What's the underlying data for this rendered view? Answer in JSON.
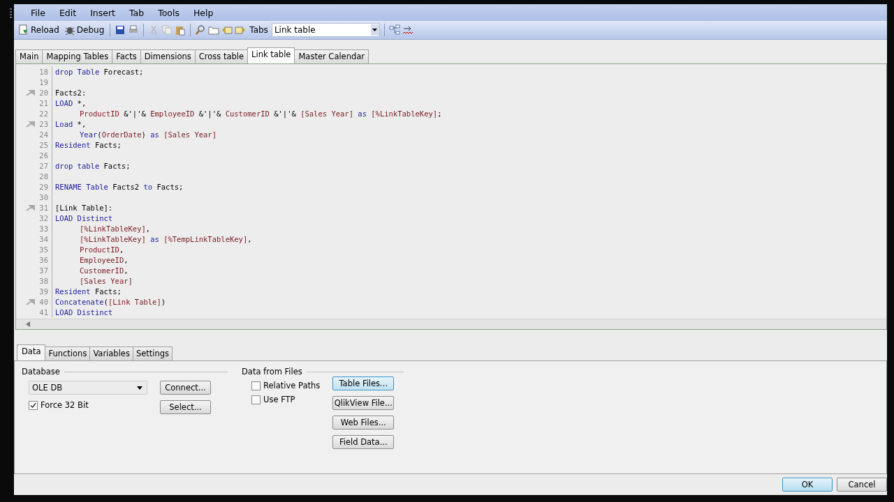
{
  "menu": [
    "File",
    "Edit",
    "Insert",
    "Tab",
    "Tools",
    "Help"
  ],
  "toolbar": {
    "reload": "Reload",
    "debug": "Debug",
    "tabs_label": "Tabs",
    "tabs_value": "Link table"
  },
  "script_tabs": [
    {
      "label": "Main",
      "selected": false
    },
    {
      "label": "Mapping Tables",
      "selected": false
    },
    {
      "label": "Facts",
      "selected": false
    },
    {
      "label": "Dimensions",
      "selected": false
    },
    {
      "label": "Cross table",
      "selected": false
    },
    {
      "label": "Link table",
      "selected": true
    },
    {
      "label": "Master Calendar",
      "selected": false
    }
  ],
  "editor": {
    "lines": [
      {
        "number": "18",
        "bookmark": false,
        "indent": false,
        "tokens": [
          {
            "kind": "keyword",
            "text": "drop Table"
          },
          {
            "kind": "plain",
            "text": " Forecast;"
          }
        ]
      },
      {
        "number": "19",
        "bookmark": false
      },
      {
        "number": "20",
        "bookmark": true,
        "indent": false,
        "tokens": [
          {
            "kind": "plain",
            "text": "Facts2:"
          }
        ]
      },
      {
        "number": "21",
        "bookmark": false,
        "indent": false,
        "tokens": [
          {
            "kind": "keyword",
            "text": "LOAD"
          },
          {
            "kind": "plain",
            "text": " *,"
          }
        ]
      },
      {
        "number": "22",
        "bookmark": false,
        "indent": true,
        "tokens": [
          {
            "kind": "field",
            "text": "ProductID"
          },
          {
            "kind": "plain",
            "text": " &'|'& "
          },
          {
            "kind": "field",
            "text": "EmployeeID"
          },
          {
            "kind": "plain",
            "text": " &'|'& "
          },
          {
            "kind": "field",
            "text": "CustomerID"
          },
          {
            "kind": "plain",
            "text": " &'|'& "
          },
          {
            "kind": "field",
            "text": "[Sales Year] "
          },
          {
            "kind": "keyword",
            "text": "as "
          },
          {
            "kind": "field",
            "text": "[%LinkTableKey]"
          },
          {
            "kind": "plain",
            "text": ";"
          }
        ]
      },
      {
        "number": "23",
        "bookmark": true,
        "indent": false,
        "tokens": [
          {
            "kind": "keyword",
            "text": "Load"
          },
          {
            "kind": "plain",
            "text": " *,"
          }
        ]
      },
      {
        "number": "24",
        "bookmark": false,
        "indent": true,
        "tokens": [
          {
            "kind": "keyword",
            "text": "Year"
          },
          {
            "kind": "plain",
            "text": "("
          },
          {
            "kind": "field",
            "text": "OrderDate"
          },
          {
            "kind": "plain",
            "text": ") "
          },
          {
            "kind": "keyword",
            "text": "as "
          },
          {
            "kind": "field",
            "text": "[Sales Year]"
          }
        ]
      },
      {
        "number": "25",
        "bookmark": false,
        "indent": false,
        "tokens": [
          {
            "kind": "keyword",
            "text": "Resident"
          },
          {
            "kind": "plain",
            "text": " Facts;"
          }
        ]
      },
      {
        "number": "26",
        "bookmark": false
      },
      {
        "number": "27",
        "bookmark": false,
        "indent": false,
        "tokens": [
          {
            "kind": "keyword",
            "text": "drop table"
          },
          {
            "kind": "plain",
            "text": " Facts;"
          }
        ]
      },
      {
        "number": "28",
        "bookmark": false
      },
      {
        "number": "29",
        "bookmark": false,
        "indent": false,
        "tokens": [
          {
            "kind": "keyword",
            "text": "RENAME Table"
          },
          {
            "kind": "plain",
            "text": " Facts2 "
          },
          {
            "kind": "keyword",
            "text": "to"
          },
          {
            "kind": "plain",
            "text": " Facts;"
          }
        ]
      },
      {
        "number": "30",
        "bookmark": false
      },
      {
        "number": "31",
        "bookmark": true,
        "indent": false,
        "tokens": [
          {
            "kind": "plain",
            "text": "[Link Table]:"
          }
        ]
      },
      {
        "number": "32",
        "bookmark": false,
        "indent": false,
        "tokens": [
          {
            "kind": "keyword",
            "text": "LOAD Distinct"
          }
        ]
      },
      {
        "number": "33",
        "bookmark": false,
        "indent": true,
        "tokens": [
          {
            "kind": "field",
            "text": "[%LinkTableKey]"
          },
          {
            "kind": "plain",
            "text": ","
          }
        ]
      },
      {
        "number": "34",
        "bookmark": false,
        "indent": true,
        "tokens": [
          {
            "kind": "field",
            "text": "[%LinkTableKey] "
          },
          {
            "kind": "keyword",
            "text": "as "
          },
          {
            "kind": "field",
            "text": "[%TempLinkTableKey]"
          },
          {
            "kind": "plain",
            "text": ","
          }
        ]
      },
      {
        "number": "35",
        "bookmark": false,
        "indent": true,
        "tokens": [
          {
            "kind": "field",
            "text": "ProductID"
          },
          {
            "kind": "plain",
            "text": ","
          }
        ]
      },
      {
        "number": "36",
        "bookmark": false,
        "indent": true,
        "tokens": [
          {
            "kind": "field",
            "text": "EmployeeID"
          },
          {
            "kind": "plain",
            "text": ","
          }
        ]
      },
      {
        "number": "37",
        "bookmark": false,
        "indent": true,
        "tokens": [
          {
            "kind": "field",
            "text": "CustomerID"
          },
          {
            "kind": "plain",
            "text": ","
          }
        ]
      },
      {
        "number": "38",
        "bookmark": false,
        "indent": true,
        "tokens": [
          {
            "kind": "field",
            "text": "[Sales Year]"
          }
        ]
      },
      {
        "number": "39",
        "bookmark": false,
        "indent": false,
        "tokens": [
          {
            "kind": "keyword",
            "text": "Resident"
          },
          {
            "kind": "plain",
            "text": " Facts;"
          }
        ]
      },
      {
        "number": "40",
        "bookmark": true,
        "indent": false,
        "tokens": [
          {
            "kind": "keyword",
            "text": "Concatenate"
          },
          {
            "kind": "plain",
            "text": "("
          },
          {
            "kind": "field",
            "text": "[Link Table]"
          },
          {
            "kind": "plain",
            "text": ")"
          }
        ]
      },
      {
        "number": "41",
        "bookmark": false,
        "indent": false,
        "tokens": [
          {
            "kind": "keyword",
            "text": "LOAD Distinct"
          }
        ]
      }
    ]
  },
  "panel_tabs": [
    {
      "label": "Data",
      "selected": true
    },
    {
      "label": "Functions",
      "selected": false
    },
    {
      "label": "Variables",
      "selected": false
    },
    {
      "label": "Settings",
      "selected": false
    }
  ],
  "database": {
    "title": "Database",
    "driver": "OLE DB",
    "force32": {
      "label": "Force 32 Bit",
      "checked": true
    },
    "buttons": [
      "Connect...",
      "Select..."
    ]
  },
  "files": {
    "title": "Data from Files",
    "options": [
      {
        "label": "Relative Paths",
        "checked": false
      },
      {
        "label": "Use FTP",
        "checked": false
      }
    ],
    "buttons": [
      {
        "label": "Table Files...",
        "focused": true
      },
      {
        "label": "QlikView File...",
        "focused": false
      },
      {
        "label": "Web Files...",
        "focused": false
      },
      {
        "label": "Field Data...",
        "focused": false
      }
    ]
  },
  "footer": [
    {
      "label": "OK",
      "default": true
    },
    {
      "label": "Cancel",
      "default": false
    }
  ]
}
